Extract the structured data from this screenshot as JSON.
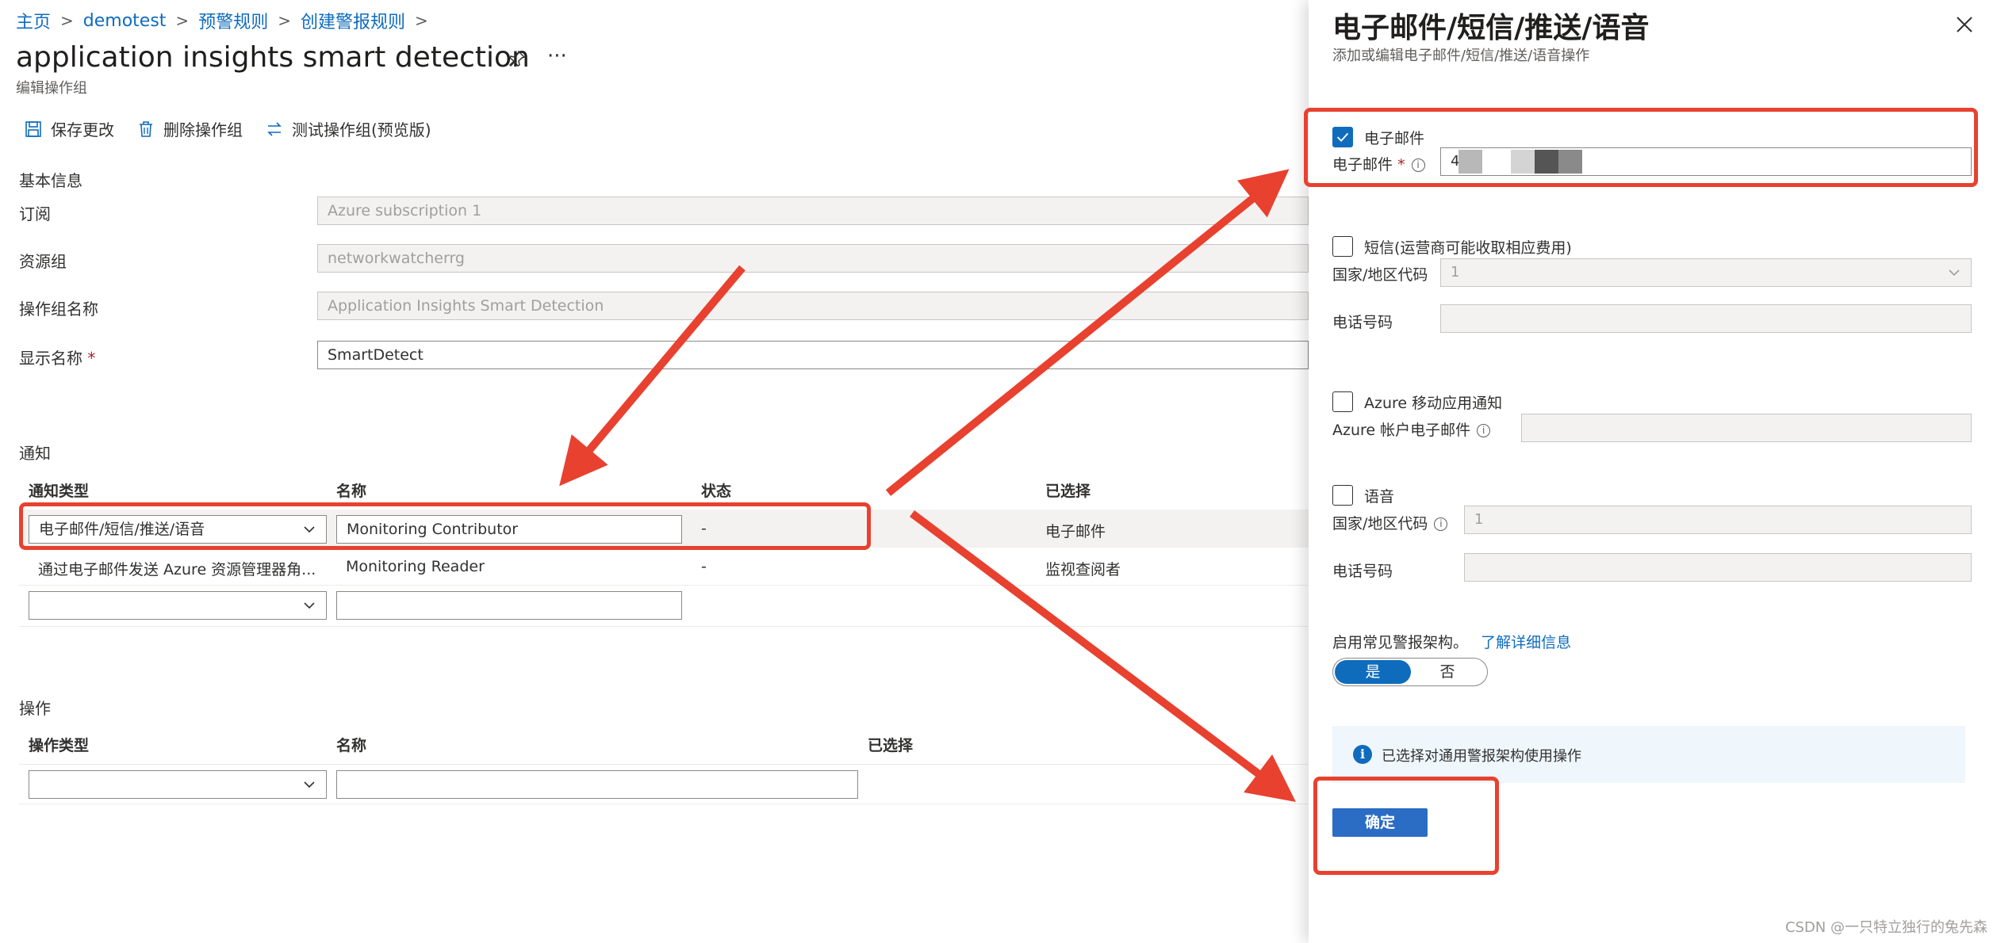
{
  "breadcrumb": [
    "主页",
    "demotest",
    "预警规则",
    "创建警报规则"
  ],
  "page": {
    "title": "application insights smart detection",
    "subtitle": "编辑操作组"
  },
  "toolbar": {
    "save": "保存更改",
    "delete": "删除操作组",
    "test": "测试操作组(预览版)"
  },
  "basics": {
    "heading": "基本信息",
    "subscription_label": "订阅",
    "subscription_value": "Azure subscription 1",
    "rg_label": "资源组",
    "rg_value": "networkwatcherrg",
    "name_label": "操作组名称",
    "name_value": "Application Insights Smart Detection",
    "display_label": "显示名称",
    "display_value": "SmartDetect",
    "required_mark": "*"
  },
  "notifications": {
    "heading": "通知",
    "col_type": "通知类型",
    "col_name": "名称",
    "col_status": "状态",
    "col_selected": "已选择",
    "rows": [
      {
        "type": "电子邮件/短信/推送/语音",
        "name": "Monitoring Contributor",
        "status": "-",
        "selected": "电子邮件"
      },
      {
        "type": "通过电子邮件发送 Azure 资源管理器角...",
        "name": "Monitoring Reader",
        "status": "-",
        "selected": "监视查阅者"
      }
    ]
  },
  "actions": {
    "heading": "操作",
    "col_type": "操作类型",
    "col_name": "名称",
    "col_selected": "已选择"
  },
  "panel": {
    "title": "电子邮件/短信/推送/语音",
    "subtitle": "添加或编辑电子邮件/短信/推送/语音操作",
    "email_check": "电子邮件",
    "email_label": "电子邮件",
    "email_value": "4",
    "sms_check": "短信(运营商可能收取相应费用)",
    "sms_country_label": "国家/地区代码",
    "sms_country_value": "1",
    "sms_phone_label": "电话号码",
    "push_check": "Azure 移动应用通知",
    "push_email_label": "Azure 帐户电子邮件",
    "voice_check": "语音",
    "voice_country_label": "国家/地区代码",
    "voice_country_value": "1",
    "voice_phone_label": "电话号码",
    "schema_label": "启用常见警报架构。",
    "schema_link": "了解详细信息",
    "toggle_yes": "是",
    "toggle_no": "否",
    "info_text": "已选择对通用警报架构使用操作",
    "ok": "确定"
  },
  "watermark": "CSDN @一只特立独行的兔先森",
  "colors": {
    "accent": "#0f6cbd",
    "annotation": "#e8412f"
  }
}
